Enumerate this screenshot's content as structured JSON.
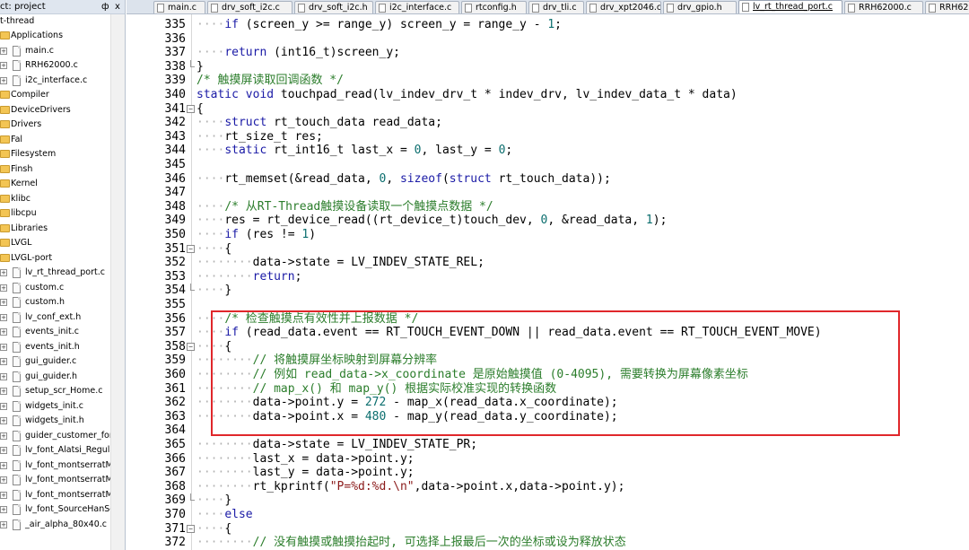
{
  "panel": {
    "title": "ct: project",
    "pin": "ф",
    "close": "x",
    "tree": [
      {
        "label": "t-thread",
        "level": 0,
        "kind": "root"
      },
      {
        "label": "Applications",
        "level": 1,
        "kind": "folder"
      },
      {
        "label": "main.c",
        "level": 2,
        "kind": "file"
      },
      {
        "label": "RRH62000.c",
        "level": 2,
        "kind": "file"
      },
      {
        "label": "i2c_interface.c",
        "level": 2,
        "kind": "file"
      },
      {
        "label": "Compiler",
        "level": 1,
        "kind": "folder"
      },
      {
        "label": "DeviceDrivers",
        "level": 1,
        "kind": "folder"
      },
      {
        "label": "Drivers",
        "level": 1,
        "kind": "folder"
      },
      {
        "label": "Fal",
        "level": 1,
        "kind": "folder"
      },
      {
        "label": "Filesystem",
        "level": 1,
        "kind": "folder"
      },
      {
        "label": "Finsh",
        "level": 1,
        "kind": "folder"
      },
      {
        "label": "Kernel",
        "level": 1,
        "kind": "folder"
      },
      {
        "label": "klibc",
        "level": 1,
        "kind": "folder"
      },
      {
        "label": "libcpu",
        "level": 1,
        "kind": "folder"
      },
      {
        "label": "Libraries",
        "level": 1,
        "kind": "folder"
      },
      {
        "label": "LVGL",
        "level": 1,
        "kind": "folder"
      },
      {
        "label": "LVGL-port",
        "level": 1,
        "kind": "folder"
      },
      {
        "label": "lv_rt_thread_port.c",
        "level": 2,
        "kind": "file"
      },
      {
        "label": "custom.c",
        "level": 2,
        "kind": "file"
      },
      {
        "label": "custom.h",
        "level": 2,
        "kind": "file"
      },
      {
        "label": "lv_conf_ext.h",
        "level": 2,
        "kind": "file"
      },
      {
        "label": "events_init.c",
        "level": 2,
        "kind": "file"
      },
      {
        "label": "events_init.h",
        "level": 2,
        "kind": "file"
      },
      {
        "label": "gui_guider.c",
        "level": 2,
        "kind": "file"
      },
      {
        "label": "gui_guider.h",
        "level": 2,
        "kind": "file"
      },
      {
        "label": "setup_scr_Home.c",
        "level": 2,
        "kind": "file"
      },
      {
        "label": "widgets_init.c",
        "level": 2,
        "kind": "file"
      },
      {
        "label": "widgets_init.h",
        "level": 2,
        "kind": "file"
      },
      {
        "label": "guider_customer_font",
        "level": 2,
        "kind": "file"
      },
      {
        "label": "lv_font_Alatsi_Regular",
        "level": 2,
        "kind": "file"
      },
      {
        "label": "lv_font_montserratMe",
        "level": 2,
        "kind": "file"
      },
      {
        "label": "lv_font_montserratMe",
        "level": 2,
        "kind": "file"
      },
      {
        "label": "lv_font_montserratMe",
        "level": 2,
        "kind": "file"
      },
      {
        "label": "lv_font_SourceHanSer",
        "level": 2,
        "kind": "file"
      },
      {
        "label": "_air_alpha_80x40.c",
        "level": 2,
        "kind": "file"
      }
    ]
  },
  "tabs": [
    {
      "label": "main.c",
      "active": false
    },
    {
      "label": "drv_soft_i2c.c",
      "active": false
    },
    {
      "label": "drv_soft_i2c.h",
      "active": false
    },
    {
      "label": "i2c_interface.c",
      "active": false
    },
    {
      "label": "rtconfig.h",
      "active": false
    },
    {
      "label": "drv_tli.c",
      "active": false
    },
    {
      "label": "drv_xpt2046.c",
      "active": false
    },
    {
      "label": "drv_gpio.h",
      "active": false
    },
    {
      "label": "lv_rt_thread_port.c",
      "active": true
    },
    {
      "label": "RRH62000.c",
      "active": false
    },
    {
      "label": "RRH6200",
      "active": false
    }
  ],
  "editor": {
    "lines": [
      {
        "n": "335",
        "fold": "",
        "code": "\t\tif (screen_y >= range_y) screen_y = range_y - 1;"
      },
      {
        "n": "336",
        "fold": "",
        "code": ""
      },
      {
        "n": "337",
        "fold": "",
        "code": "\t\treturn (int16_t)screen_y;"
      },
      {
        "n": "338",
        "fold": "end",
        "code": "}"
      },
      {
        "n": "339",
        "fold": "",
        "code": "/* 触摸屏读取回调函数 */"
      },
      {
        "n": "340",
        "fold": "",
        "code": "static void touchpad_read(lv_indev_drv_t * indev_drv, lv_indev_data_t * data)"
      },
      {
        "n": "341",
        "fold": "minus",
        "code": "{"
      },
      {
        "n": "342",
        "fold": "",
        "code": "\t\tstruct rt_touch_data read_data;"
      },
      {
        "n": "343",
        "fold": "",
        "code": "\t\trt_size_t res;"
      },
      {
        "n": "344",
        "fold": "",
        "code": "\t\tstatic rt_int16_t last_x = 0, last_y = 0;"
      },
      {
        "n": "345",
        "fold": "",
        "code": ""
      },
      {
        "n": "346",
        "fold": "",
        "code": "\t\trt_memset(&read_data, 0, sizeof(struct rt_touch_data));"
      },
      {
        "n": "347",
        "fold": "",
        "code": ""
      },
      {
        "n": "348",
        "fold": "",
        "code": "\t\t/* 从RT-Thread触摸设备读取一个触摸点数据 */"
      },
      {
        "n": "349",
        "fold": "",
        "code": "\t\tres = rt_device_read((rt_device_t)touch_dev, 0, &read_data, 1);"
      },
      {
        "n": "350",
        "fold": "",
        "code": "\t\tif (res != 1)"
      },
      {
        "n": "351",
        "fold": "minus",
        "code": "\t\t{"
      },
      {
        "n": "352",
        "fold": "",
        "code": "\t\t\t\tdata->state = LV_INDEV_STATE_REL;"
      },
      {
        "n": "353",
        "fold": "",
        "code": "\t\t\t\treturn;"
      },
      {
        "n": "354",
        "fold": "end",
        "code": "\t\t}"
      },
      {
        "n": "355",
        "fold": "",
        "code": ""
      },
      {
        "n": "356",
        "fold": "",
        "code": "\t\t/* 检查触摸点有效性并上报数据 */"
      },
      {
        "n": "357",
        "fold": "",
        "code": "\t\tif (read_data.event == RT_TOUCH_EVENT_DOWN || read_data.event == RT_TOUCH_EVENT_MOVE)"
      },
      {
        "n": "358",
        "fold": "minus",
        "code": "\t\t{"
      },
      {
        "n": "359",
        "fold": "",
        "code": "\t\t\t\t// 将触摸屏坐标映射到屏幕分辨率"
      },
      {
        "n": "360",
        "fold": "",
        "code": "\t\t\t\t// 例如 read_data->x_coordinate 是原始触摸值 (0-4095), 需要转换为屏幕像素坐标"
      },
      {
        "n": "361",
        "fold": "",
        "code": "\t\t\t\t// map_x() 和 map_y() 根据实际校准实现的转换函数"
      },
      {
        "n": "362",
        "fold": "",
        "code": "\t\t\t\tdata->point.y = 272 - map_x(read_data.x_coordinate);"
      },
      {
        "n": "363",
        "fold": "",
        "code": "\t\t\t\tdata->point.x = 480 - map_y(read_data.y_coordinate);"
      },
      {
        "n": "364",
        "fold": "",
        "code": ""
      },
      {
        "n": "365",
        "fold": "",
        "code": "\t\t\t\tdata->state = LV_INDEV_STATE_PR;"
      },
      {
        "n": "366",
        "fold": "",
        "code": "\t\t\t\tlast_x = data->point.y;"
      },
      {
        "n": "367",
        "fold": "",
        "code": "\t\t\t\tlast_y = data->point.y;"
      },
      {
        "n": "368",
        "fold": "",
        "code": "\t\t\t\trt_kprintf(\"P=%d:%d.\\n\",data->point.x,data->point.y);"
      },
      {
        "n": "369",
        "fold": "end",
        "code": "\t\t}"
      },
      {
        "n": "370",
        "fold": "",
        "code": "\t\telse"
      },
      {
        "n": "371",
        "fold": "minus",
        "code": "\t\t{"
      },
      {
        "n": "372",
        "fold": "",
        "code": "\t\t\t\t// 没有触摸或触摸抬起时, 可选择上报最后一次的坐标或设为释放状态"
      }
    ]
  },
  "colors": {
    "keyword": "#1a1aa6",
    "comment": "#2b7d2b",
    "number": "#0b6e6e",
    "string": "#8b1a1a",
    "highlight_box": "#e0272b"
  }
}
